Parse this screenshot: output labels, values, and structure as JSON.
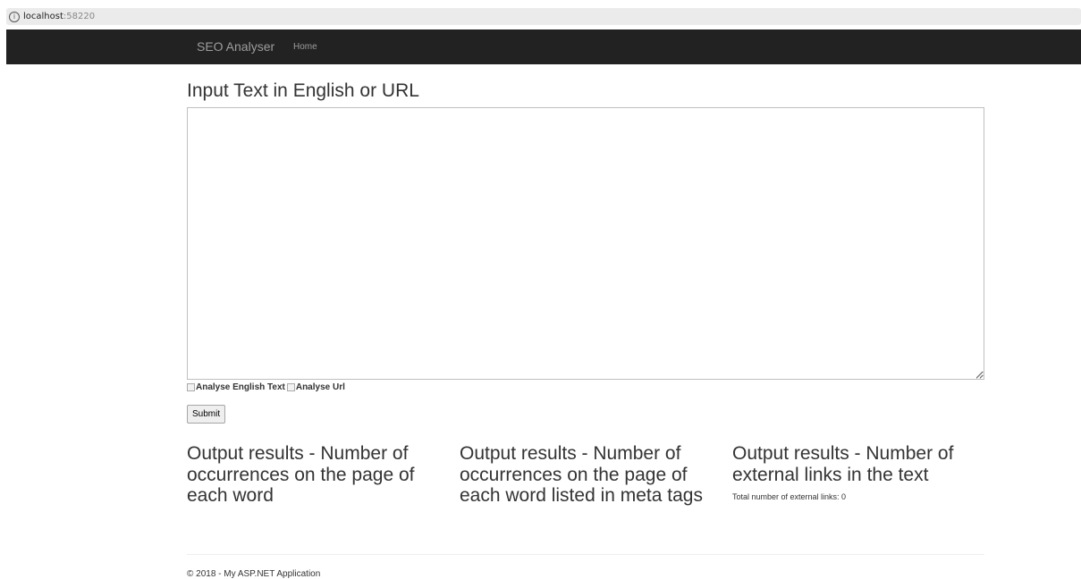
{
  "browser": {
    "host": "localhost",
    "port": ":58220",
    "info_glyph": "i"
  },
  "navbar": {
    "brand": "SEO Analyser",
    "links": [
      "Home"
    ]
  },
  "main": {
    "heading": "Input Text in English or URL",
    "textarea_value": "",
    "options": [
      {
        "label": "Analyse English Text",
        "checked": false
      },
      {
        "label": "Analyse Url",
        "checked": false
      }
    ],
    "submit_label": "Submit"
  },
  "results": [
    {
      "title": "Output results - Number of occurrences on the page of each word"
    },
    {
      "title": "Output results - Number of occurrences on the page of each word listed in meta tags"
    },
    {
      "title": "Output results - Number of external links in the text",
      "detail": "Total number of external links: 0"
    }
  ],
  "footer": {
    "text": "© 2018 - My ASP.NET Application"
  },
  "colors": {
    "navbar_bg": "#222222",
    "nav_text": "#9d9d9d",
    "body_text": "#333333"
  }
}
